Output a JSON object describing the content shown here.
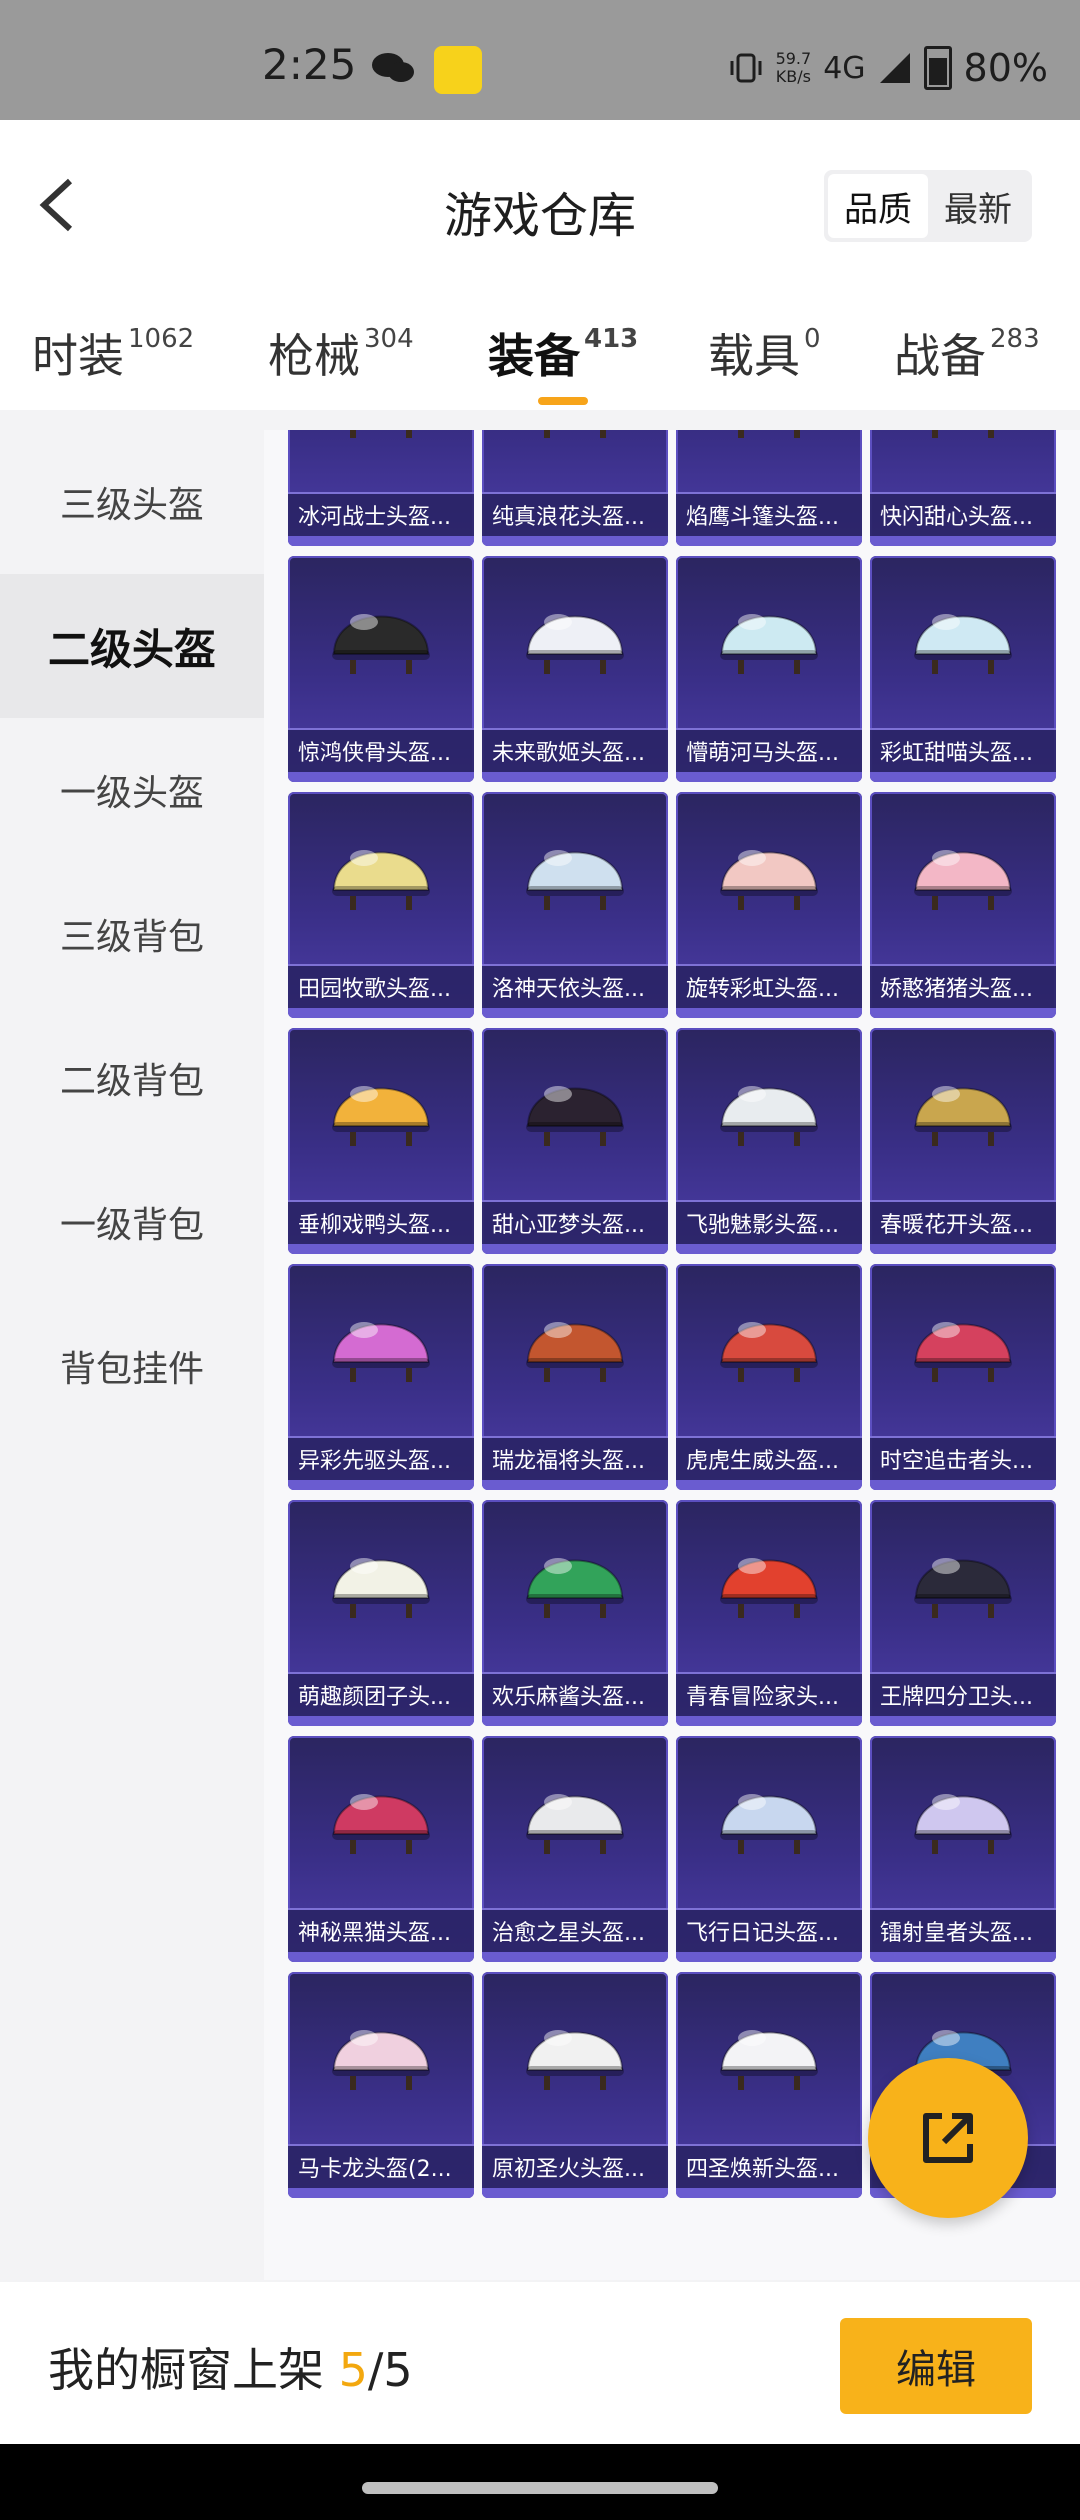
{
  "status_bar": {
    "time": "2:25",
    "net_speed": "59.7",
    "net_unit": "KB/s",
    "network": "4G",
    "battery": "80%"
  },
  "header": {
    "title": "游戏仓库",
    "sort_options": [
      "品质",
      "最新"
    ],
    "active_sort": "品质"
  },
  "tabs": [
    {
      "label": "时装",
      "count": "1062"
    },
    {
      "label": "枪械",
      "count": "304"
    },
    {
      "label": "装备",
      "count": "413"
    },
    {
      "label": "载具",
      "count": "0"
    },
    {
      "label": "战备",
      "count": "283"
    }
  ],
  "sidebar": {
    "items": [
      "三级头盔",
      "二级头盔",
      "一级头盔",
      "三级背包",
      "二级背包",
      "一级背包",
      "背包挂件"
    ],
    "active": "二级头盔"
  },
  "items": [
    [
      "冰河战士头盔...",
      "纯真浪花头盔...",
      "焰鹰斗篷头盔...",
      "快闪甜心头盔..."
    ],
    [
      "惊鸿侠骨头盔...",
      "未来歌姬头盔...",
      "懵萌河马头盔...",
      "彩虹甜喵头盔..."
    ],
    [
      "田园牧歌头盔...",
      "洛神天依头盔...",
      "旋转彩虹头盔...",
      "娇憨猪猪头盔..."
    ],
    [
      "垂柳戏鸭头盔...",
      "甜心亚梦头盔...",
      "飞驰魅影头盔...",
      "春暖花开头盔..."
    ],
    [
      "异彩先驱头盔...",
      "瑞龙福将头盔...",
      "虎虎生威头盔...",
      "时空追击者头..."
    ],
    [
      "萌趣颜团子头...",
      "欢乐麻酱头盔...",
      "青春冒险家头...",
      "王牌四分卫头..."
    ],
    [
      "神秘黑猫头盔...",
      "治愈之星头盔...",
      "飞行日记头盔...",
      "镭射皇者头盔..."
    ],
    [
      "马卡龙头盔(2...",
      "原初圣火头盔...",
      "四圣焕新头盔...",
      "..."
    ]
  ],
  "helmet_colors": [
    [
      "#d7e4ef",
      "#f2e9f6",
      "#e8d2c4",
      "#f6c7cf"
    ],
    [
      "#2a2a2a",
      "#eef0f6",
      "#cdeaf2",
      "#cfe9f3"
    ],
    [
      "#eadc8d",
      "#cfe0ef",
      "#f2c8c3",
      "#f3b7c6"
    ],
    [
      "#f2b23b",
      "#2b2230",
      "#e8ecef",
      "#c9a64e"
    ],
    [
      "#d46bd2",
      "#c3562f",
      "#d84a3e",
      "#d5415e"
    ],
    [
      "#f2f2e6",
      "#32a35a",
      "#e2412e",
      "#2b2a3a"
    ],
    [
      "#cf3a62",
      "#e9eaec",
      "#c8d7ef",
      "#cfc7ef"
    ],
    [
      "#f0d0df",
      "#f1f1f1",
      "#f3f3f6",
      "#3f7fc1"
    ]
  ],
  "footer": {
    "prefix": "我的橱窗上架 ",
    "current": "5",
    "sep": "/",
    "total": "5",
    "edit_label": "编辑"
  }
}
